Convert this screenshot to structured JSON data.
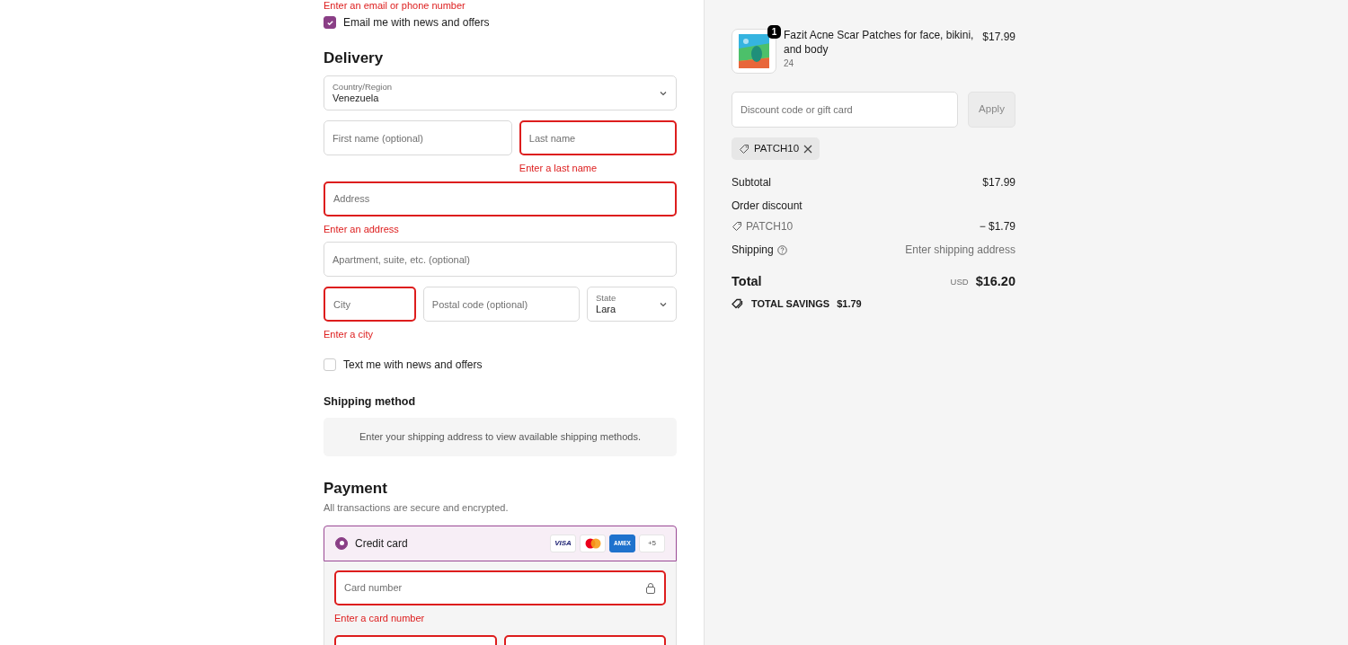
{
  "contact": {
    "error": "Enter an email or phone number",
    "email_offers": {
      "label": "Email me with news and offers",
      "checked": true
    }
  },
  "delivery": {
    "title": "Delivery",
    "rows": [
      [
        {
          "kind": "select",
          "label": "Country/Region",
          "value": "Venezuela",
          "invalid": false
        }
      ],
      [
        {
          "kind": "input",
          "placeholder": "First name (optional)",
          "invalid": false
        },
        {
          "kind": "input",
          "placeholder": "Last name",
          "invalid": true,
          "error": "Enter a last name"
        }
      ],
      [
        {
          "kind": "input",
          "placeholder": "Address",
          "invalid": true,
          "error": "Enter an address"
        }
      ],
      [
        {
          "kind": "input",
          "placeholder": "Apartment, suite, etc. (optional)",
          "invalid": false
        }
      ],
      [
        {
          "kind": "input",
          "placeholder": "City",
          "invalid": true,
          "error": "Enter a city"
        },
        {
          "kind": "input",
          "placeholder": "Postal code (optional)",
          "invalid": false
        },
        {
          "kind": "select",
          "label": "State",
          "value": "Lara",
          "invalid": false
        }
      ]
    ],
    "sms_offers": {
      "label": "Text me with news and offers",
      "checked": false
    }
  },
  "shipping_method": {
    "title": "Shipping method",
    "message": "Enter your shipping address to view available shipping methods."
  },
  "payment": {
    "title": "Payment",
    "subtitle": "All transactions are secure and encrypted.",
    "methods": [
      {
        "label": "Credit card",
        "selected": true,
        "brands": [
          {
            "kind": "visa",
            "text": "VISA"
          },
          {
            "kind": "mastercard"
          },
          {
            "kind": "amex",
            "text": "AMEX"
          }
        ],
        "more": "+5"
      }
    ],
    "card_rows": [
      [
        {
          "kind": "card",
          "placeholder": "Card number",
          "invalid": true,
          "error": "Enter a card number"
        }
      ],
      [
        {
          "kind": "input",
          "invalid": true
        },
        {
          "kind": "input",
          "invalid": true
        }
      ]
    ]
  },
  "summary": {
    "item": {
      "quantity": "1",
      "name": "Fazit Acne Scar Patches for face, bikini, and body",
      "variant": "24",
      "price": "$17.99"
    },
    "discount": {
      "placeholder": "Discount code or gift card",
      "button": "Apply",
      "disabled": true
    },
    "codes": [
      {
        "code": "PATCH10"
      }
    ],
    "lines": [
      {
        "kind": "plain",
        "label": "Subtotal",
        "value": "$17.99"
      },
      {
        "kind": "discount",
        "label": "Order discount",
        "code": "PATCH10",
        "value": "− $1.79"
      },
      {
        "kind": "help",
        "label": "Shipping",
        "value": "Enter shipping address"
      }
    ],
    "total": {
      "label": "Total",
      "currency": "USD",
      "amount": "$16.20"
    },
    "savings": {
      "label": "TOTAL SAVINGS",
      "amount": "$1.79"
    }
  }
}
